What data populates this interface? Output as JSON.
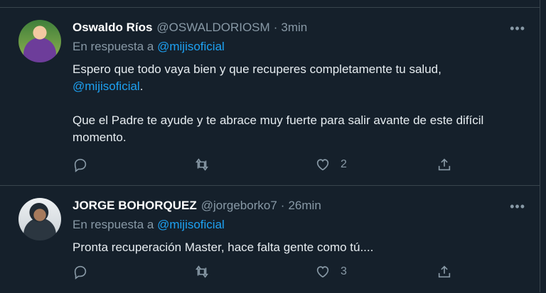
{
  "tweets": [
    {
      "name": "Oswaldo Ríos",
      "handle": "@OSWALDORIOSM",
      "separator": "·",
      "time": "3min",
      "more": "•••",
      "reply_prefix": "En respuesta a",
      "reply_to": "@mijisoficial",
      "text_1": "Espero que todo vaya bien y que recuperes completamente tu salud,",
      "mention": "@mijisoficial",
      "text_1_end": ".",
      "text_2": "Que el Padre te ayude y te abrace muy fuerte para salir avante de este difícil momento.",
      "likes": "2"
    },
    {
      "name": "JORGE BOHORQUEZ",
      "handle": "@jorgeborko7",
      "separator": "·",
      "time": "26min",
      "more": "•••",
      "reply_prefix": "En respuesta a",
      "reply_to": "@mijisoficial",
      "text_1": "Pronta recuperación Master, hace falta gente como tú....",
      "likes": "3"
    }
  ],
  "icons": {
    "reply": "reply-icon",
    "retweet": "retweet-icon",
    "like": "heart-icon",
    "share": "share-icon",
    "more": "more-icon"
  },
  "colors": {
    "background": "#15202b",
    "border": "#38444d",
    "muted": "#8899a6",
    "link": "#1da1f2",
    "text": "#e6ecf0"
  }
}
